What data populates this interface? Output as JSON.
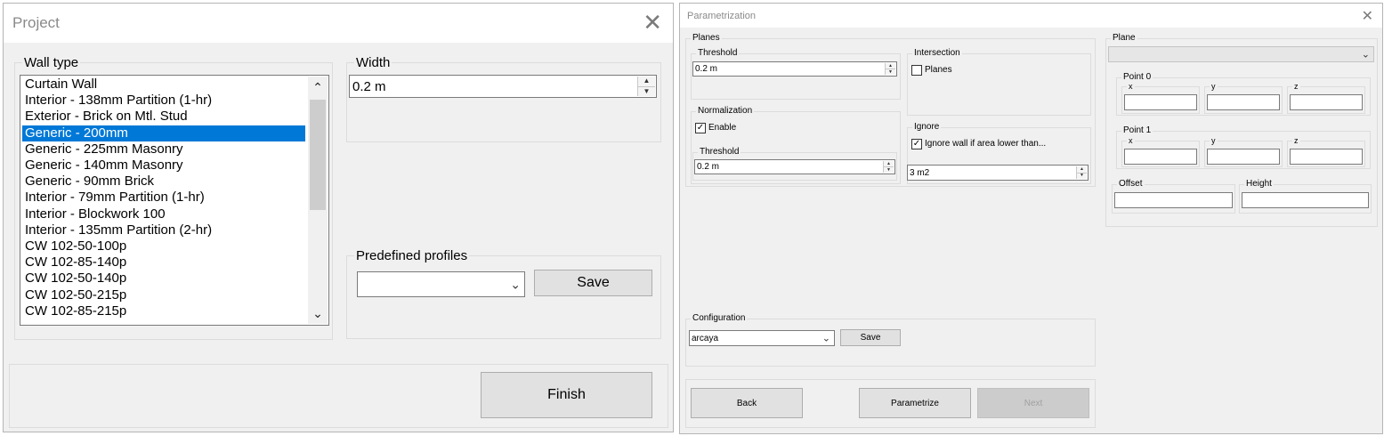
{
  "project": {
    "title": "Project",
    "close": "✕",
    "wall_type": {
      "label": "Wall type",
      "items": [
        "Curtain Wall",
        "Interior - 138mm Partition (1-hr)",
        "Exterior - Brick on Mtl. Stud",
        "Generic - 200mm",
        "Generic - 225mm Masonry",
        "Generic - 140mm Masonry",
        "Generic - 90mm Brick",
        "Interior - 79mm Partition (1-hr)",
        "Interior - Blockwork 100",
        "Interior - 135mm Partition (2-hr)",
        "CW 102-50-100p",
        "CW 102-85-140p",
        "CW 102-50-140p",
        "CW 102-50-215p",
        "CW 102-85-215p"
      ],
      "selected": "Generic - 200mm"
    },
    "width": {
      "label": "Width",
      "value": "0.2 m"
    },
    "profiles": {
      "label": "Predefined profiles",
      "selected": "",
      "save_label": "Save"
    },
    "finish_label": "Finish"
  },
  "param": {
    "title": "Parametrization",
    "close": "✕",
    "planes": {
      "label": "Planes",
      "threshold_label": "Threshold",
      "threshold_value": "0.2 m",
      "intersection_label": "Intersection",
      "intersection_planes_label": "Planes",
      "intersection_planes_checked": false,
      "normalization_label": "Normalization",
      "normalization_enable_label": "Enable",
      "normalization_enable_checked": true,
      "norm_threshold_label": "Threshold",
      "norm_threshold_value": "0.2 m",
      "ignore_label": "Ignore",
      "ignore_checkbox_label": "Ignore wall if area lower than...",
      "ignore_checked": true,
      "ignore_value": "3 m2"
    },
    "configuration": {
      "label": "Configuration",
      "selected": "arcaya",
      "save_label": "Save"
    },
    "back_label": "Back",
    "parametrize_label": "Parametrize",
    "next_label": "Next",
    "plane": {
      "label": "Plane",
      "selected": "",
      "point0_label": "Point 0",
      "point1_label": "Point 1",
      "x_label": "x",
      "y_label": "y",
      "z_label": "z",
      "offset_label": "Offset",
      "height_label": "Height"
    }
  }
}
